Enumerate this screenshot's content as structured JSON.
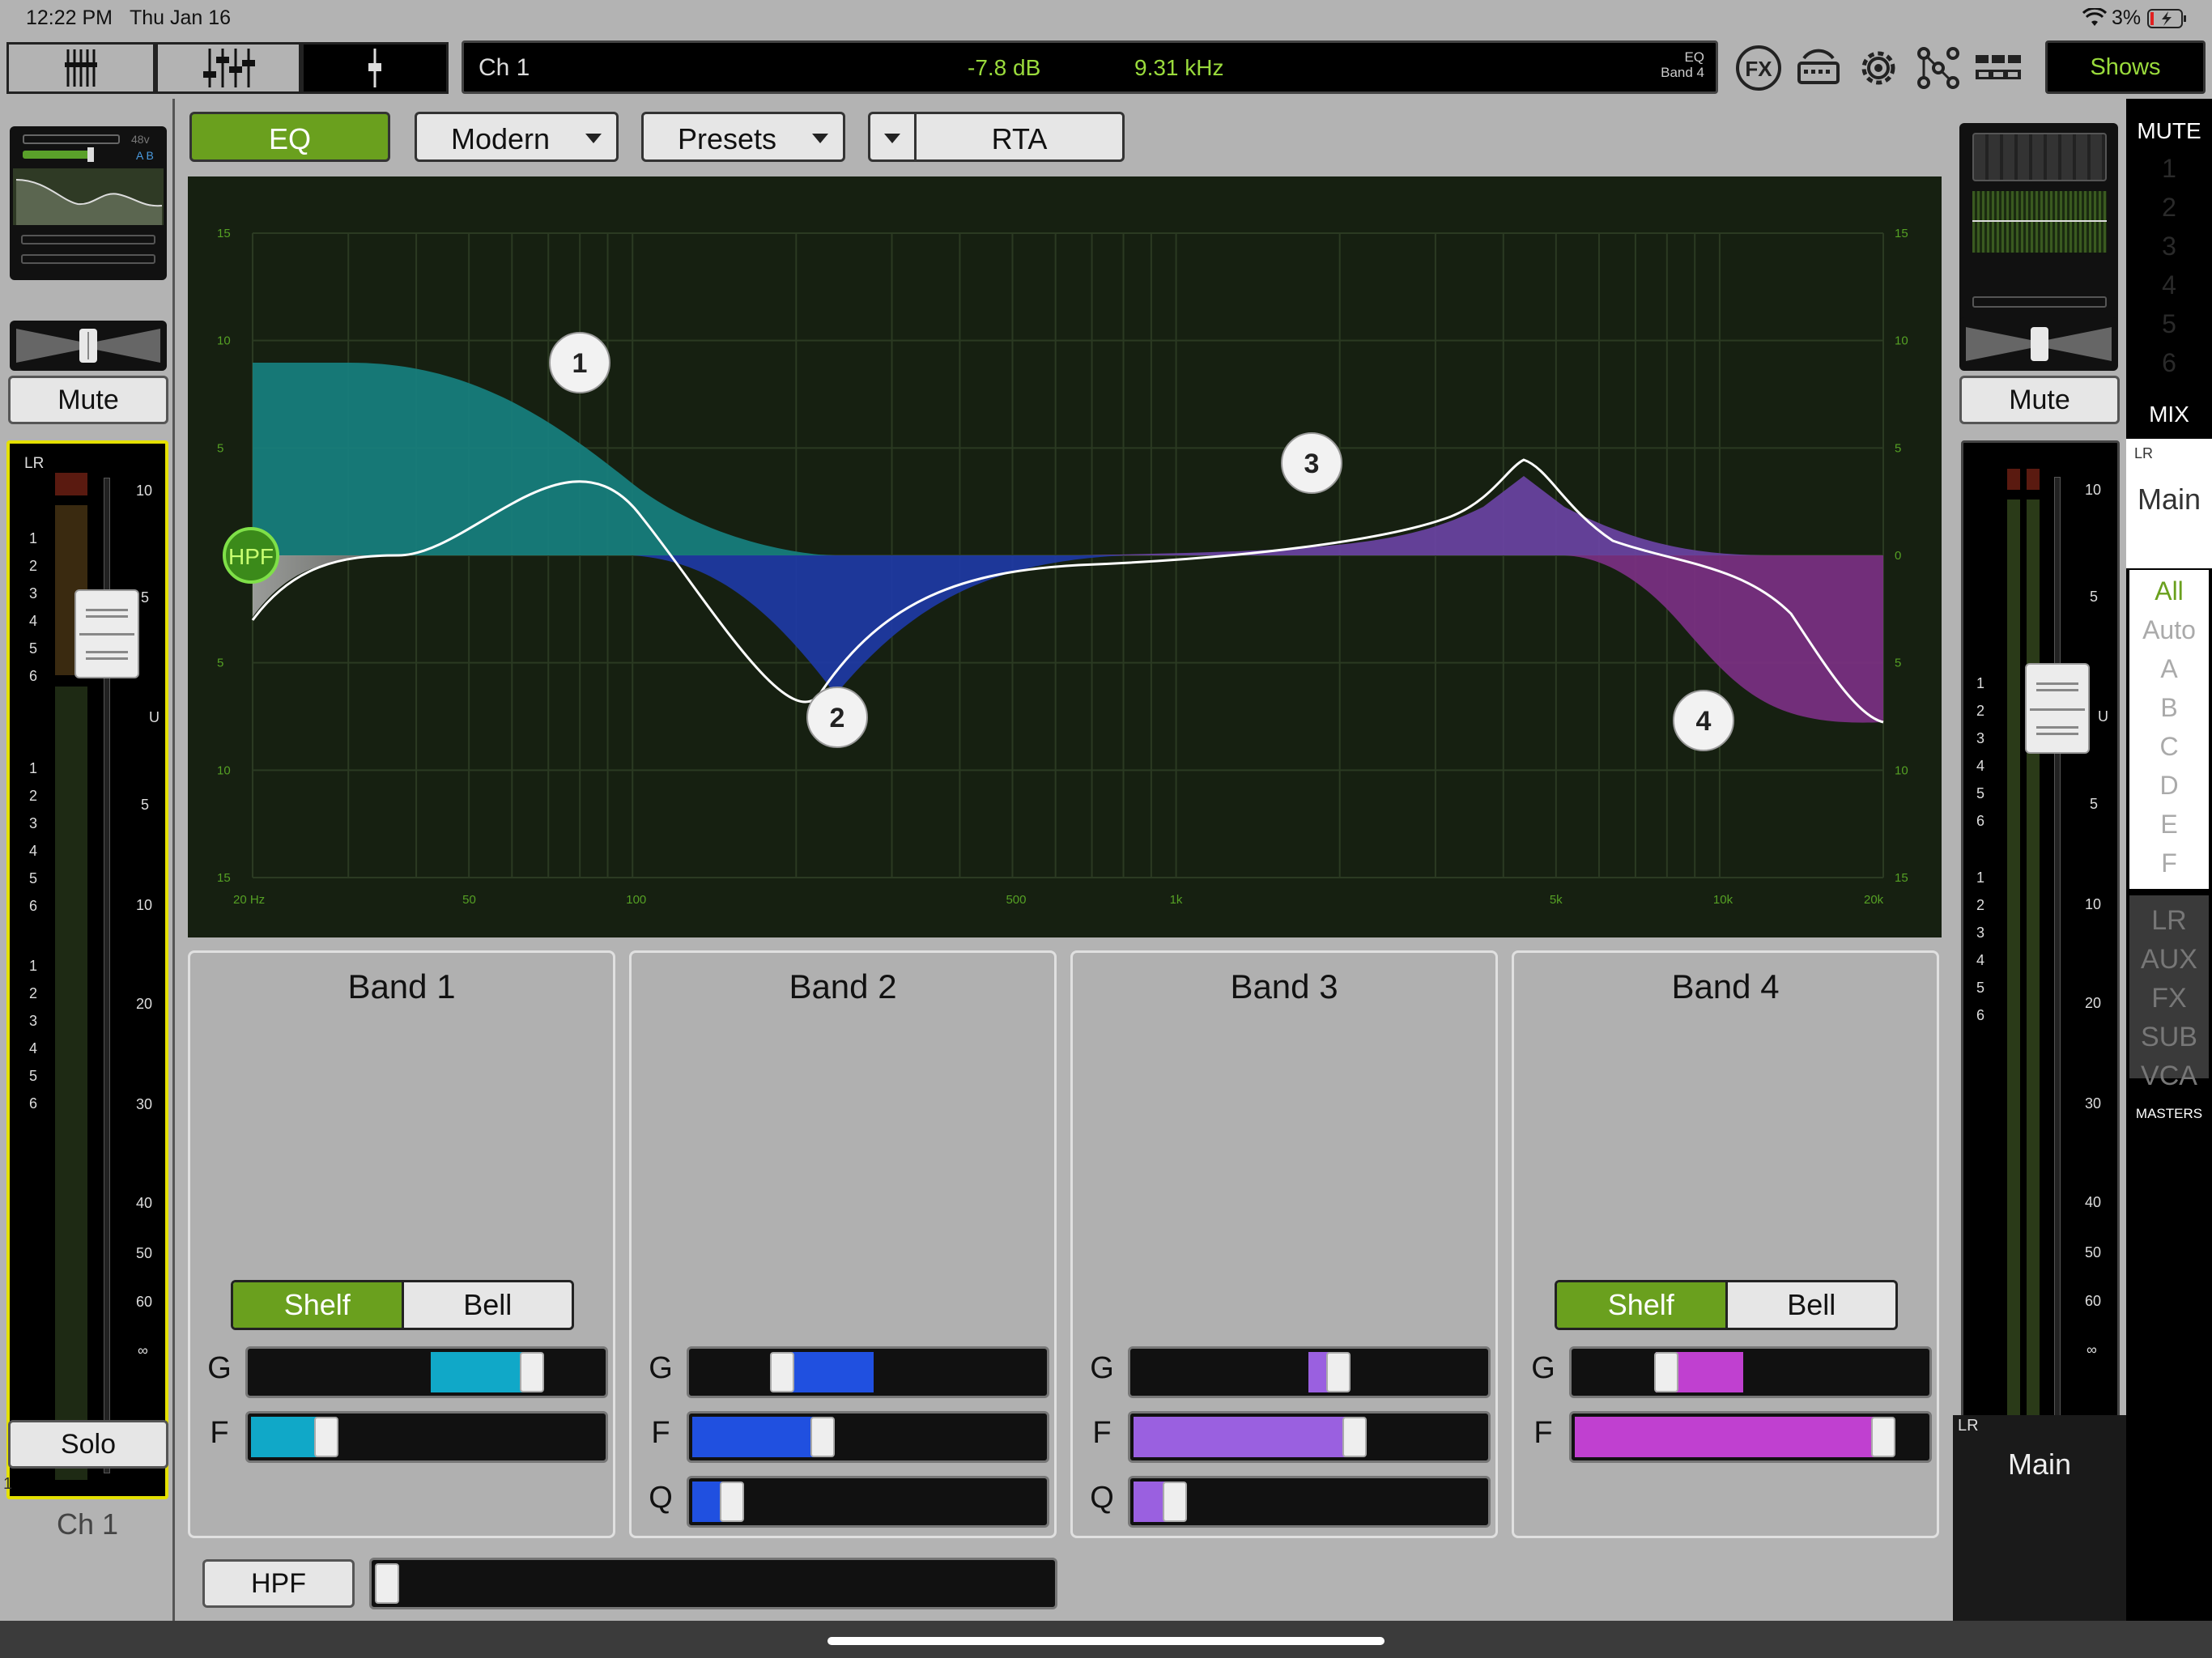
{
  "status_bar": {
    "time": "12:22 PM",
    "date": "Thu Jan 16",
    "battery": "3%"
  },
  "toolbar": {
    "channel": "Ch 1",
    "gain_readout": "-7.8 dB",
    "freq_readout": "9.31 kHz",
    "eq_label": "EQ",
    "band_label": "Band 4",
    "shows_label": "Shows"
  },
  "left_strip": {
    "phantom": "48v",
    "ab": "A B",
    "mute_label": "Mute",
    "lr_label": "LR",
    "solo_label": "Solo",
    "channel_number": "1",
    "channel_name": "Ch 1",
    "fader_scale": [
      "10",
      "5",
      "U",
      "5",
      "10",
      "20",
      "30",
      "40",
      "50",
      "60",
      "∞"
    ]
  },
  "tabs": {
    "eq": "EQ",
    "mode": "Modern",
    "presets": "Presets",
    "rta": "RTA"
  },
  "graph": {
    "db_labels": [
      "15",
      "10",
      "5",
      "0",
      "5",
      "10",
      "15"
    ],
    "freq_labels": [
      "20 Hz",
      "50",
      "100",
      "500",
      "1k",
      "5k",
      "10k",
      "20k"
    ],
    "hpf_label": "HPF",
    "handles": [
      "1",
      "2",
      "3",
      "4"
    ]
  },
  "bands": [
    {
      "title": "Band 1",
      "shelf": "Shelf",
      "bell": "Bell",
      "g_label": "G",
      "f_label": "F",
      "color": "#10a8c8"
    },
    {
      "title": "Band 2",
      "g_label": "G",
      "f_label": "F",
      "q_label": "Q",
      "color": "#2050e0"
    },
    {
      "title": "Band 3",
      "g_label": "G",
      "f_label": "F",
      "q_label": "Q",
      "color": "#9a60e0"
    },
    {
      "title": "Band 4",
      "shelf": "Shelf",
      "bell": "Bell",
      "g_label": "G",
      "f_label": "F",
      "color": "#c040d0"
    }
  ],
  "hpf_button": "HPF",
  "right_strip": {
    "mute_label": "Mute",
    "lr_label": "LR",
    "main_label": "Main",
    "fader_scale": [
      "10",
      "5",
      "U",
      "5",
      "10",
      "20",
      "30",
      "40",
      "50",
      "60",
      "∞"
    ]
  },
  "mute_nav": {
    "title": "MUTE",
    "groups": [
      "1",
      "2",
      "3",
      "4",
      "5",
      "6"
    ],
    "mix_title": "MIX",
    "lr": "LR",
    "main": "Main",
    "mix_items": [
      "All",
      "Auto",
      "A",
      "B",
      "C",
      "D",
      "E",
      "F"
    ],
    "masters": [
      "LR",
      "AUX",
      "FX",
      "SUB",
      "VCA"
    ],
    "masters_label": "MASTERS"
  },
  "colors": {
    "accent_green": "#6aa01e",
    "readout_green": "#9adb3c"
  }
}
